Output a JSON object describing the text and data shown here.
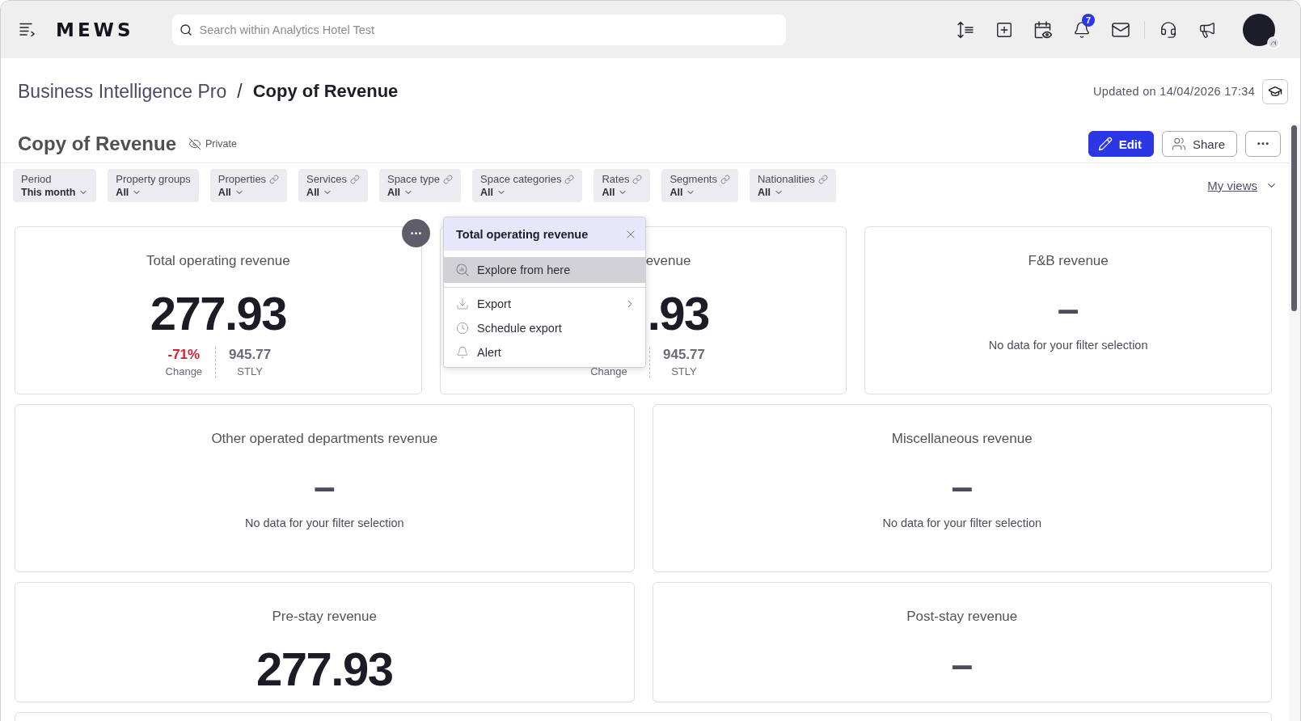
{
  "top_bar": {
    "logo": "MEWS",
    "search": {
      "placeholder": "Search within Analytics Hotel Test"
    },
    "notification_count": "7"
  },
  "breadcrumb": [
    {
      "label": "Business Intelligence Pro",
      "current": false
    },
    {
      "label": "Copy of Revenue",
      "current": true
    }
  ],
  "breadcrumb_separator": "/",
  "updated": "Updated on 14/04/2026 17:34",
  "page": {
    "title": "Copy of Revenue",
    "visibility": "Private"
  },
  "actions": [
    {
      "kind": "primary",
      "label": "Edit"
    },
    {
      "kind": "secondary",
      "label": "Share"
    },
    {
      "kind": "more"
    }
  ],
  "filters": [
    {
      "label": "Period",
      "value": "This month",
      "linked": false
    },
    {
      "label": "Property groups",
      "value": "All",
      "linked": false
    },
    {
      "label": "Properties",
      "value": "All",
      "linked": true
    },
    {
      "label": "Services",
      "value": "All",
      "linked": true
    },
    {
      "label": "Space type",
      "value": "All",
      "linked": true
    },
    {
      "label": "Space categories",
      "value": "All",
      "linked": true
    },
    {
      "label": "Rates",
      "value": "All",
      "linked": true
    },
    {
      "label": "Segments",
      "value": "All",
      "linked": true
    },
    {
      "label": "Nationalities",
      "value": "All",
      "linked": true
    }
  ],
  "my_views": "My views",
  "rows": [
    {
      "cards": [
        {
          "kind": "metric",
          "title": "Total operating revenue",
          "value": "277.93",
          "change": "-71%",
          "negative": true,
          "change_label": "Change",
          "stly": "945.77",
          "stly_label": "STLY"
        },
        {
          "kind": "covered",
          "title": "evenue",
          "value": ".93",
          "change_label": "Change",
          "stly": "945.77",
          "stly_label": "STLY"
        },
        {
          "kind": "empty",
          "title": "F&B revenue",
          "value": "–",
          "message": "No data for your filter selection"
        }
      ]
    },
    {
      "cards": [
        {
          "kind": "empty",
          "title": "Other operated departments revenue",
          "value": "–",
          "message": "No data for your filter selection"
        },
        {
          "kind": "empty",
          "title": "Miscellaneous revenue",
          "value": "–",
          "message": "No data for your filter selection"
        }
      ]
    },
    {
      "cards": [
        {
          "kind": "metric",
          "title": "Pre-stay revenue",
          "value": "277.93"
        },
        {
          "kind": "empty",
          "title": "Post-stay revenue",
          "value": "–"
        }
      ]
    },
    {
      "cards": [
        {
          "kind": "blank"
        }
      ]
    }
  ],
  "card_menu": {
    "title": "Total operating revenue",
    "groups": [
      {
        "items": [
          {
            "label": "Explore from here",
            "selected": true,
            "submenu": false
          }
        ]
      },
      {
        "items": [
          {
            "label": "Export",
            "selected": false,
            "submenu": true
          },
          {
            "label": "Schedule export",
            "selected": false,
            "submenu": false
          },
          {
            "label": "Alert",
            "selected": false,
            "submenu": false
          }
        ]
      }
    ]
  }
}
